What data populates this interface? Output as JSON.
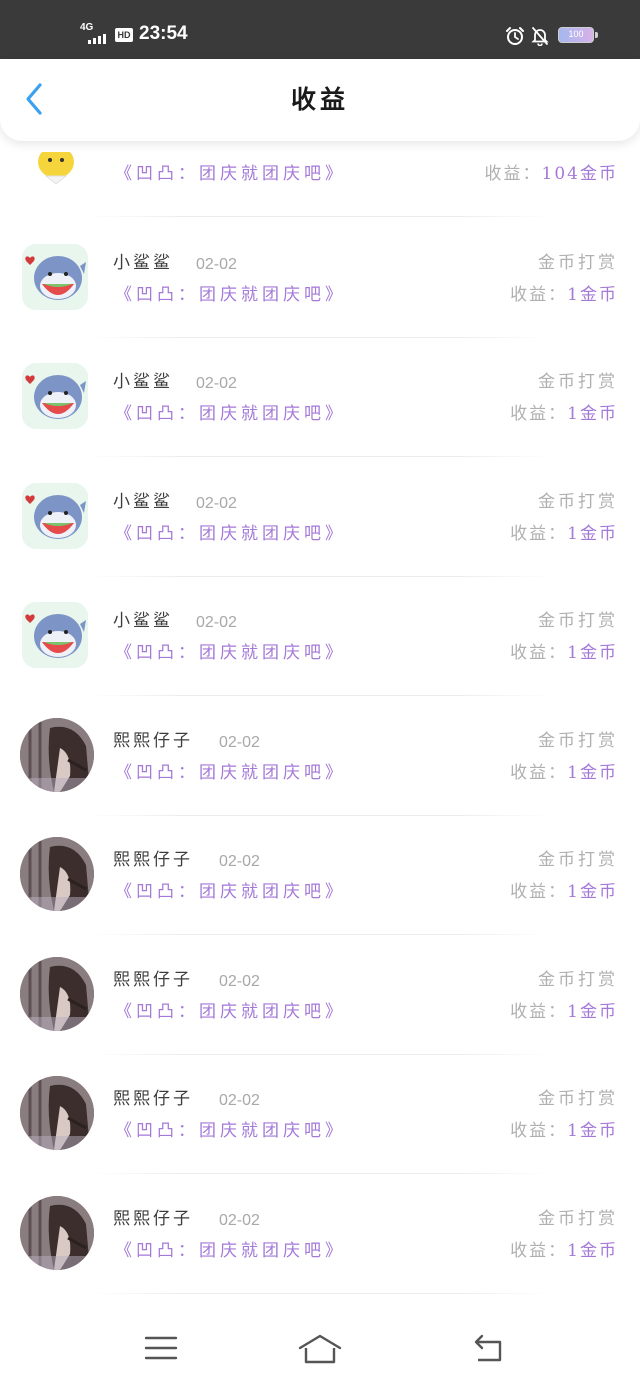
{
  "status_bar": {
    "network": "4G",
    "hd": "HD",
    "time": "23:54",
    "battery": "100",
    "icons": [
      "signal-icon",
      "alarm-icon",
      "mute-icon",
      "battery-icon"
    ]
  },
  "header": {
    "title": "收益",
    "back_icon": "chevron-left-icon"
  },
  "colors": {
    "accent_purple": "#a479d8",
    "back_blue": "#3aa1f0",
    "muted_text": "#b0b0b0"
  },
  "rows": [
    {
      "avatar": "chick-avatar",
      "name": "",
      "date": "",
      "work": "《凹凸：团庆就团庆吧》",
      "type": "",
      "earn_label": "收益：",
      "earn_value": "104金币"
    },
    {
      "avatar": "shark-avatar",
      "name": "小鲨鲨",
      "date": "02-02",
      "work": "《凹凸：团庆就团庆吧》",
      "type": "金币打赏",
      "earn_label": "收益：",
      "earn_value": "1金币"
    },
    {
      "avatar": "shark-avatar",
      "name": "小鲨鲨",
      "date": "02-02",
      "work": "《凹凸：团庆就团庆吧》",
      "type": "金币打赏",
      "earn_label": "收益：",
      "earn_value": "1金币"
    },
    {
      "avatar": "shark-avatar",
      "name": "小鲨鲨",
      "date": "02-02",
      "work": "《凹凸：团庆就团庆吧》",
      "type": "金币打赏",
      "earn_label": "收益：",
      "earn_value": "1金币"
    },
    {
      "avatar": "shark-avatar",
      "name": "小鲨鲨",
      "date": "02-02",
      "work": "《凹凸：团庆就团庆吧》",
      "type": "金币打赏",
      "earn_label": "收益：",
      "earn_value": "1金币"
    },
    {
      "avatar": "girl-avatar",
      "name": "熙熙仔子",
      "date": "02-02",
      "work": "《凹凸：团庆就团庆吧》",
      "type": "金币打赏",
      "earn_label": "收益：",
      "earn_value": "1金币"
    },
    {
      "avatar": "girl-avatar",
      "name": "熙熙仔子",
      "date": "02-02",
      "work": "《凹凸：团庆就团庆吧》",
      "type": "金币打赏",
      "earn_label": "收益：",
      "earn_value": "1金币"
    },
    {
      "avatar": "girl-avatar",
      "name": "熙熙仔子",
      "date": "02-02",
      "work": "《凹凸：团庆就团庆吧》",
      "type": "金币打赏",
      "earn_label": "收益：",
      "earn_value": "1金币"
    },
    {
      "avatar": "girl-avatar",
      "name": "熙熙仔子",
      "date": "02-02",
      "work": "《凹凸：团庆就团庆吧》",
      "type": "金币打赏",
      "earn_label": "收益：",
      "earn_value": "1金币"
    },
    {
      "avatar": "girl-avatar",
      "name": "熙熙仔子",
      "date": "02-02",
      "work": "《凹凸：团庆就团庆吧》",
      "type": "金币打赏",
      "earn_label": "收益：",
      "earn_value": "1金币"
    }
  ],
  "bottom_nav": {
    "icons": [
      "menu-icon",
      "home-icon",
      "back-icon"
    ]
  }
}
